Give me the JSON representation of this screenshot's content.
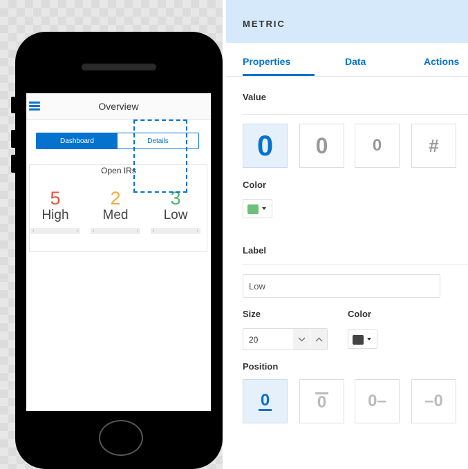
{
  "phone": {
    "app_title": "Overview",
    "segments": {
      "active": "Dashboard",
      "inactive": "Details"
    },
    "metric_title": "Open IRs",
    "metrics": [
      {
        "value": "5",
        "label": "High",
        "color": "#e8553e"
      },
      {
        "value": "2",
        "label": "Med",
        "color": "#f2a83b"
      },
      {
        "value": "3",
        "label": "Low",
        "color": "#56b36b"
      }
    ],
    "scroll_left": "‹",
    "scroll_right": "›"
  },
  "panel": {
    "title": "METRIC",
    "tabs": {
      "properties": "Properties",
      "data": "Data",
      "actions": "Actions"
    },
    "value_section": {
      "heading": "Value",
      "sizes": [
        "0",
        "0",
        "0"
      ],
      "format_symbol": "#",
      "color_label": "Color",
      "color": "#6cc07a"
    },
    "label_section": {
      "heading": "Label",
      "value": "Low",
      "size_label": "Size",
      "size_value": "20",
      "color_label": "Color",
      "color": "#444444",
      "position_label": "Position",
      "position_options": [
        "0",
        "0",
        "0–",
        "–0"
      ]
    }
  }
}
